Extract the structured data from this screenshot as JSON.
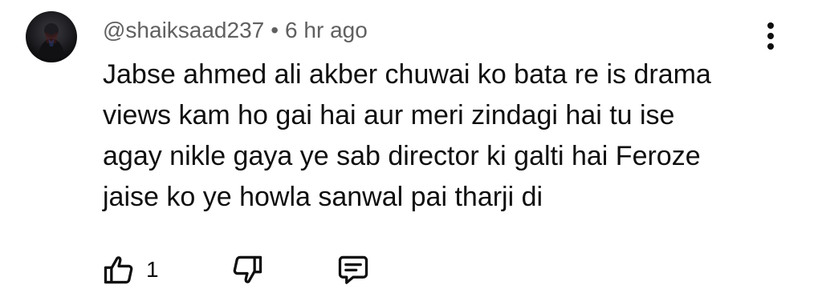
{
  "comment": {
    "author": "@shaiksaad237",
    "separator": "•",
    "timestamp": "6 hr ago",
    "text_lines": [
      "Jabse ahmed ali akber chuwai ko bata re is drama",
      "views kam ho gai hai aur meri zindagi hai tu ise",
      "agay nikle gaya ye sab director ki galti hai Feroze",
      "jaise ko ye howla sanwal pai tharji di"
    ],
    "like_count": "1"
  },
  "icons": {
    "avatar": "avatar-image",
    "menu": "more-vert-icon",
    "like": "thumb-up-icon",
    "dislike": "thumb-down-icon",
    "reply": "reply-comment-icon"
  },
  "colors": {
    "text_primary": "#0f0f0f",
    "text_secondary": "#606060",
    "background": "#ffffff"
  }
}
